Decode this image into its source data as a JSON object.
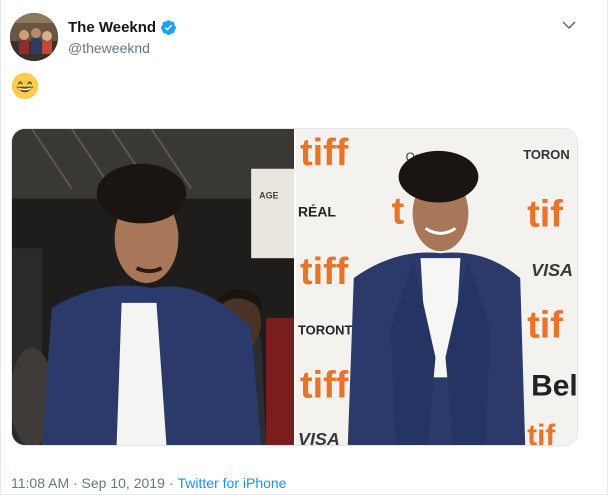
{
  "user": {
    "display_name": "The Weeknd",
    "handle": "@theweeknd",
    "verified": true,
    "avatar_icon": "avatar-photo"
  },
  "tweet": {
    "emoji": "grinning-face-with-smiling-eyes",
    "timestamp": "11:08 AM · Sep 10, 2019",
    "separator": "·",
    "source": "Twitter for iPhone"
  },
  "media": {
    "right_backdrop_text": {
      "tiff": "tiff",
      "loreal": "RÉAL",
      "toronto": "TORONTO",
      "toronto_top": "TORON",
      "visa": "VISA",
      "bell": "Bel",
      "partial_tif": "t",
      "tif": "tif",
      "ontario": "Ont"
    },
    "left_backdrop_text": "AGE"
  },
  "colors": {
    "accent": "#1b95e0",
    "verified": "#1da1f2",
    "tiff_orange": "#e8742c",
    "suit": "#2b3a6b"
  }
}
